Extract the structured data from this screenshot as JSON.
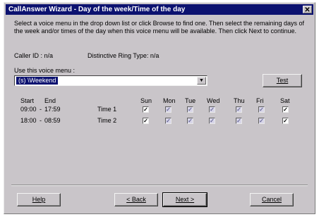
{
  "window": {
    "title": "CallAnswer Wizard - Day of the week/Time of the day",
    "close": "✕"
  },
  "instructions": "Select a voice menu in the drop down list or click Browse to find one. Then select the remaining days of the week and/or times of the day when this voice menu will be available. Then click Next to continue.",
  "caller_id": "Caller ID : n/a",
  "ring_type": "Distinctive Ring Type: n/a",
  "menu_label": "Use this voice menu :",
  "menu_value": "(s) \\Weekend",
  "menu_dropdown_icon": "▼",
  "test_button": "Test",
  "schedule": {
    "start_header": "Start",
    "end_header": "End",
    "days": [
      "Sun",
      "Mon",
      "Tue",
      "Wed",
      "Thu",
      "Fri",
      "Sat"
    ],
    "rows": [
      {
        "start": "09:00",
        "end": "17:59",
        "label": "Time 1",
        "checks": [
          true,
          false,
          false,
          false,
          false,
          false,
          true
        ]
      },
      {
        "start": "18:00",
        "end": "08:59",
        "label": "Time 2",
        "checks": [
          true,
          false,
          false,
          false,
          false,
          false,
          true
        ]
      }
    ]
  },
  "buttons": {
    "help": "Help",
    "back": "< Back",
    "next": "Next >",
    "cancel": "Cancel"
  }
}
